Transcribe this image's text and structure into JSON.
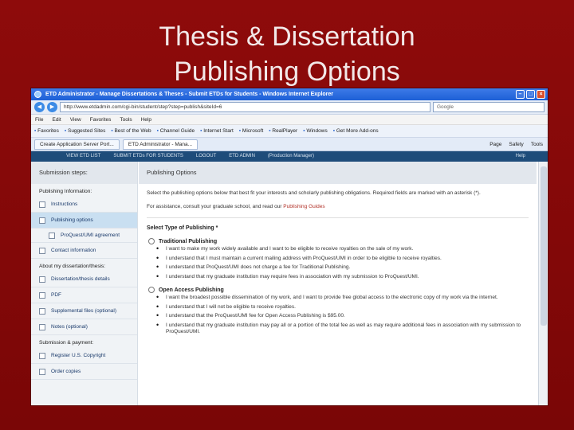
{
  "slide": {
    "title_line1": "Thesis & Dissertation",
    "title_line2": "Publishing Options"
  },
  "browser": {
    "window_title": "ETD Administrator - Manage Dissertations & Theses - Submit ETDs for Students - Windows Internet Explorer",
    "url": "http://www.etdadmin.com/cgi-bin/student/step?step=publish&siteId=6",
    "search_placeholder": "Google",
    "menu": [
      "File",
      "Edit",
      "View",
      "Favorites",
      "Tools",
      "Help"
    ],
    "favorites": [
      "Favorites",
      "Suggested Sites",
      "Best of the Web",
      "Channel Guide",
      "Internet Start",
      "Microsoft",
      "RealPlayer",
      "Windows",
      "Get More Add-ons"
    ],
    "tabs": [
      "Create Application Server Port...",
      "ETD Administrator - Mana..."
    ],
    "tab_tools": [
      "Page",
      "Safety",
      "Tools"
    ]
  },
  "app": {
    "top_links": [
      "VIEW ETD LIST",
      "SUBMIT ETDs FOR STUDENTS",
      "LOGOUT",
      "ETD ADMIN",
      "(Production Manager)"
    ],
    "help": "Help"
  },
  "sidebar": {
    "header": "Submission steps:",
    "sections": [
      {
        "title": "Publishing Information:",
        "items": [
          {
            "label": "Instructions",
            "sub": false,
            "active": false
          },
          {
            "label": "Publishing options",
            "sub": false,
            "active": true
          },
          {
            "label": "ProQuest/UMI agreement",
            "sub": true,
            "active": false
          },
          {
            "label": "Contact information",
            "sub": false,
            "active": false
          }
        ]
      },
      {
        "title": "About my dissertation/thesis:",
        "items": [
          {
            "label": "Dissertation/thesis details",
            "sub": false,
            "active": false
          },
          {
            "label": "PDF",
            "sub": false,
            "active": false
          },
          {
            "label": "Supplemental files (optional)",
            "sub": false,
            "active": false
          },
          {
            "label": "Notes (optional)",
            "sub": false,
            "active": false
          }
        ]
      },
      {
        "title": "Submission & payment:",
        "items": [
          {
            "label": "Register U.S. Copyright",
            "sub": false,
            "active": false
          },
          {
            "label": "Order copies",
            "sub": false,
            "active": false
          }
        ]
      }
    ]
  },
  "main": {
    "header": "Publishing Options",
    "intro": "Select the publishing options below that best fit your interests and scholarly publishing obligations. Required fields are marked with an asterisk (*).",
    "assist_prefix": "For assistance, consult your graduate school, and read our ",
    "assist_link": "Publishing Guides",
    "select_title": "Select Type of Publishing *",
    "options": [
      {
        "title": "Traditional Publishing",
        "bullets": [
          "I want to make my work widely available and I want to be eligible to receive royalties on the sale of my work.",
          "I understand that I must maintain a current mailing address with ProQuest/UMI in order to be eligible to receive royalties.",
          "I understand that ProQuest/UMI does not charge a fee for Traditional Publishing.",
          "I understand that my graduate institution may require fees in association with my submission to ProQuest/UMI."
        ]
      },
      {
        "title": "Open Access Publishing",
        "bullets": [
          "I want the broadest possible dissemination of my work, and I want to provide free global access to the electronic copy of my work via the internet.",
          "I understand that I will not be eligible to receive royalties.",
          "I understand that the ProQuest/UMI fee for Open Access Publishing is $95.00.",
          "I understand that my graduate institution may pay all or a portion of the total fee as well as may require additional fees in association with my submission to ProQuest/UMI."
        ]
      }
    ]
  }
}
